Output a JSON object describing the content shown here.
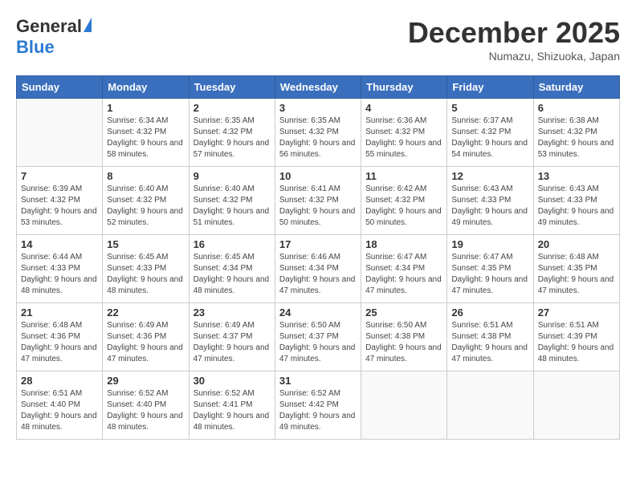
{
  "header": {
    "logo_general": "General",
    "logo_blue": "Blue",
    "month_year": "December 2025",
    "location": "Numazu, Shizuoka, Japan"
  },
  "days_of_week": [
    "Sunday",
    "Monday",
    "Tuesday",
    "Wednesday",
    "Thursday",
    "Friday",
    "Saturday"
  ],
  "weeks": [
    [
      {
        "day": "",
        "sunrise": "",
        "sunset": "",
        "daylight": ""
      },
      {
        "day": "1",
        "sunrise": "6:34 AM",
        "sunset": "4:32 PM",
        "daylight": "9 hours and 58 minutes."
      },
      {
        "day": "2",
        "sunrise": "6:35 AM",
        "sunset": "4:32 PM",
        "daylight": "9 hours and 57 minutes."
      },
      {
        "day": "3",
        "sunrise": "6:35 AM",
        "sunset": "4:32 PM",
        "daylight": "9 hours and 56 minutes."
      },
      {
        "day": "4",
        "sunrise": "6:36 AM",
        "sunset": "4:32 PM",
        "daylight": "9 hours and 55 minutes."
      },
      {
        "day": "5",
        "sunrise": "6:37 AM",
        "sunset": "4:32 PM",
        "daylight": "9 hours and 54 minutes."
      },
      {
        "day": "6",
        "sunrise": "6:38 AM",
        "sunset": "4:32 PM",
        "daylight": "9 hours and 53 minutes."
      }
    ],
    [
      {
        "day": "7",
        "sunrise": "6:39 AM",
        "sunset": "4:32 PM",
        "daylight": "9 hours and 53 minutes."
      },
      {
        "day": "8",
        "sunrise": "6:40 AM",
        "sunset": "4:32 PM",
        "daylight": "9 hours and 52 minutes."
      },
      {
        "day": "9",
        "sunrise": "6:40 AM",
        "sunset": "4:32 PM",
        "daylight": "9 hours and 51 minutes."
      },
      {
        "day": "10",
        "sunrise": "6:41 AM",
        "sunset": "4:32 PM",
        "daylight": "9 hours and 50 minutes."
      },
      {
        "day": "11",
        "sunrise": "6:42 AM",
        "sunset": "4:32 PM",
        "daylight": "9 hours and 50 minutes."
      },
      {
        "day": "12",
        "sunrise": "6:43 AM",
        "sunset": "4:33 PM",
        "daylight": "9 hours and 49 minutes."
      },
      {
        "day": "13",
        "sunrise": "6:43 AM",
        "sunset": "4:33 PM",
        "daylight": "9 hours and 49 minutes."
      }
    ],
    [
      {
        "day": "14",
        "sunrise": "6:44 AM",
        "sunset": "4:33 PM",
        "daylight": "9 hours and 48 minutes."
      },
      {
        "day": "15",
        "sunrise": "6:45 AM",
        "sunset": "4:33 PM",
        "daylight": "9 hours and 48 minutes."
      },
      {
        "day": "16",
        "sunrise": "6:45 AM",
        "sunset": "4:34 PM",
        "daylight": "9 hours and 48 minutes."
      },
      {
        "day": "17",
        "sunrise": "6:46 AM",
        "sunset": "4:34 PM",
        "daylight": "9 hours and 47 minutes."
      },
      {
        "day": "18",
        "sunrise": "6:47 AM",
        "sunset": "4:34 PM",
        "daylight": "9 hours and 47 minutes."
      },
      {
        "day": "19",
        "sunrise": "6:47 AM",
        "sunset": "4:35 PM",
        "daylight": "9 hours and 47 minutes."
      },
      {
        "day": "20",
        "sunrise": "6:48 AM",
        "sunset": "4:35 PM",
        "daylight": "9 hours and 47 minutes."
      }
    ],
    [
      {
        "day": "21",
        "sunrise": "6:48 AM",
        "sunset": "4:36 PM",
        "daylight": "9 hours and 47 minutes."
      },
      {
        "day": "22",
        "sunrise": "6:49 AM",
        "sunset": "4:36 PM",
        "daylight": "9 hours and 47 minutes."
      },
      {
        "day": "23",
        "sunrise": "6:49 AM",
        "sunset": "4:37 PM",
        "daylight": "9 hours and 47 minutes."
      },
      {
        "day": "24",
        "sunrise": "6:50 AM",
        "sunset": "4:37 PM",
        "daylight": "9 hours and 47 minutes."
      },
      {
        "day": "25",
        "sunrise": "6:50 AM",
        "sunset": "4:38 PM",
        "daylight": "9 hours and 47 minutes."
      },
      {
        "day": "26",
        "sunrise": "6:51 AM",
        "sunset": "4:38 PM",
        "daylight": "9 hours and 47 minutes."
      },
      {
        "day": "27",
        "sunrise": "6:51 AM",
        "sunset": "4:39 PM",
        "daylight": "9 hours and 48 minutes."
      }
    ],
    [
      {
        "day": "28",
        "sunrise": "6:51 AM",
        "sunset": "4:40 PM",
        "daylight": "9 hours and 48 minutes."
      },
      {
        "day": "29",
        "sunrise": "6:52 AM",
        "sunset": "4:40 PM",
        "daylight": "9 hours and 48 minutes."
      },
      {
        "day": "30",
        "sunrise": "6:52 AM",
        "sunset": "4:41 PM",
        "daylight": "9 hours and 48 minutes."
      },
      {
        "day": "31",
        "sunrise": "6:52 AM",
        "sunset": "4:42 PM",
        "daylight": "9 hours and 49 minutes."
      },
      {
        "day": "",
        "sunrise": "",
        "sunset": "",
        "daylight": ""
      },
      {
        "day": "",
        "sunrise": "",
        "sunset": "",
        "daylight": ""
      },
      {
        "day": "",
        "sunrise": "",
        "sunset": "",
        "daylight": ""
      }
    ]
  ]
}
